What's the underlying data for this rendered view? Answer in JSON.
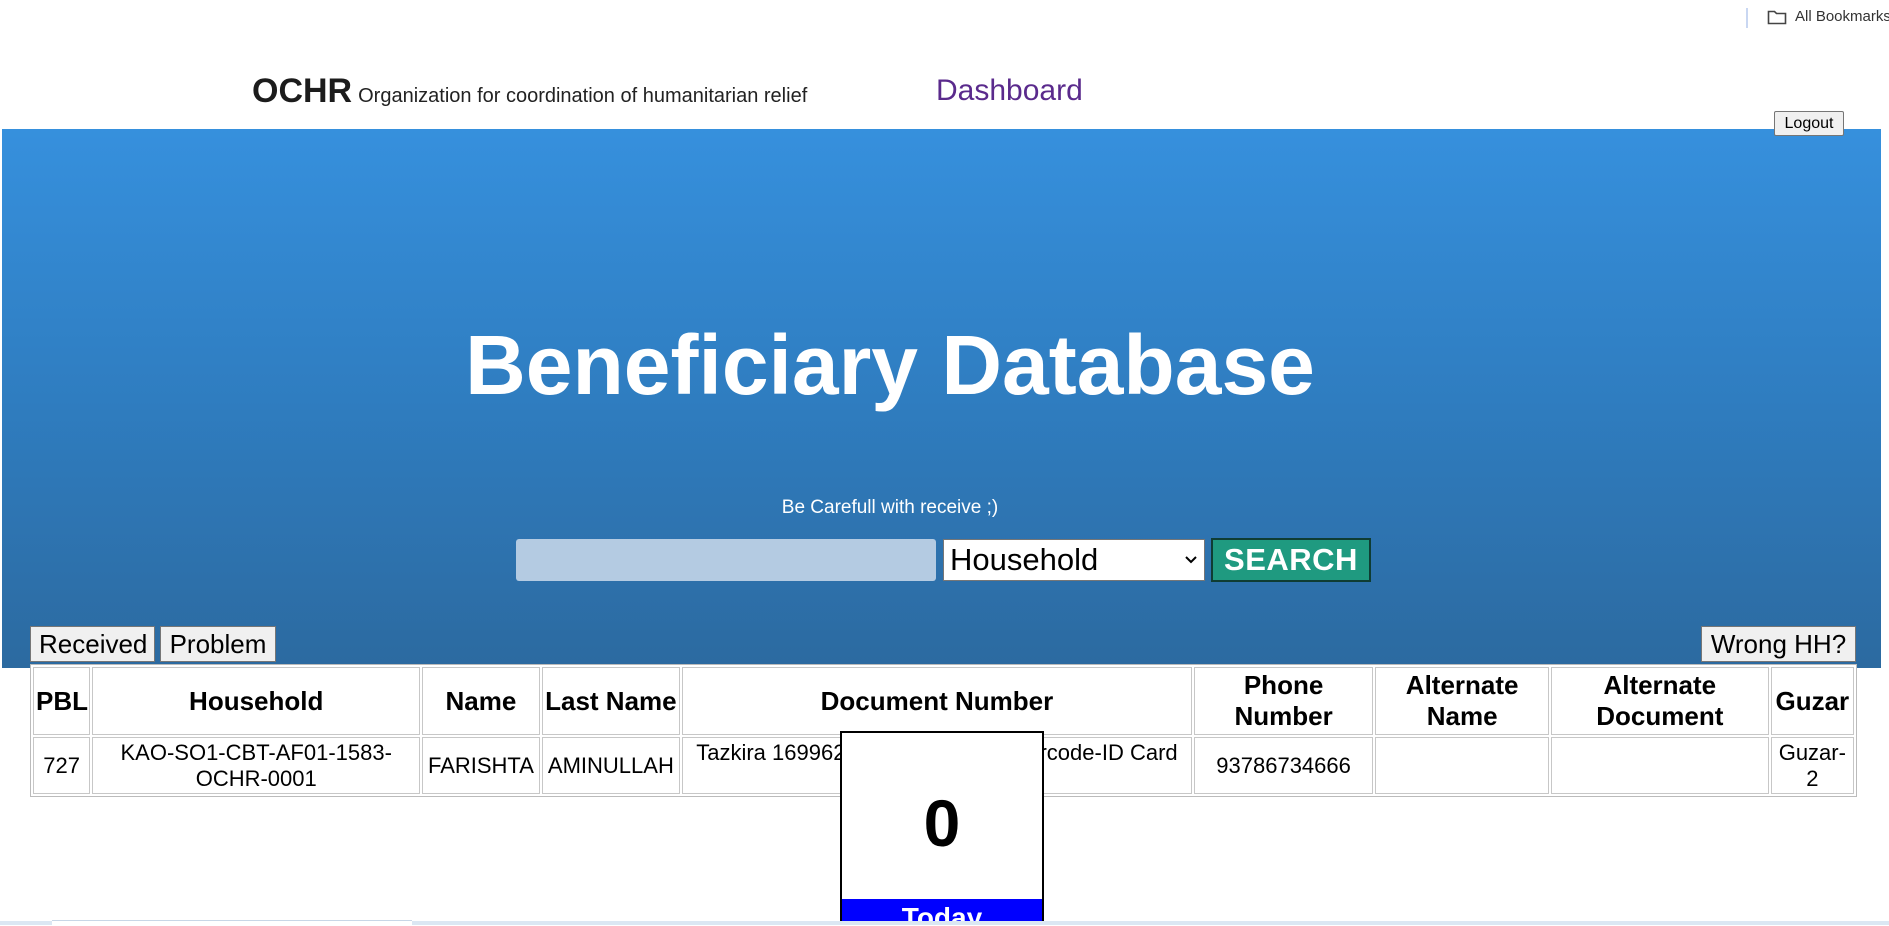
{
  "browser": {
    "bookmarks_label": "All Bookmarks"
  },
  "header": {
    "brand": "OCHR",
    "tagline": "Organization for coordination of humanitarian relief",
    "dashboard_link": "Dashboard",
    "logout_label": "Logout"
  },
  "hero": {
    "title": "Beneficiary Database",
    "subtitle": "Be Carefull with receive ;)"
  },
  "search": {
    "input_value": "",
    "select_value": "Household",
    "button_label": "SEARCH"
  },
  "actions": {
    "received": "Received",
    "problem": "Problem",
    "wrong_hh": "Wrong HH?"
  },
  "table": {
    "columns": [
      "PBL",
      "Household",
      "Name",
      "Last Name",
      "Document Number",
      "Phone Number",
      "Alternate Name",
      "Alternate Document",
      "Guzar"
    ],
    "rows": [
      {
        "pbl": "727",
        "household": "KAO-SO1-CBT-AF01-1583-OCHR-0001",
        "name": "FARISHTA",
        "last_name": "AMINULLAH",
        "document_number": "Tazkira 16996224-2-1385, WFP Barcode-ID Card 380411560-8987",
        "phone_number": "93786734666",
        "alternate_name": "",
        "alternate_document": "",
        "guzar": "Guzar-2"
      }
    ]
  },
  "counter": {
    "value": "0",
    "label": "Today",
    "label_color": "#0000ff"
  },
  "colors": {
    "panel_top": "#3690dd",
    "panel_bottom": "#2c6aa0",
    "search_button": "#1f9a80",
    "dashboard_link": "#5a2a8c"
  },
  "icons": [
    "folder-icon",
    "chevron-down-icon"
  ]
}
